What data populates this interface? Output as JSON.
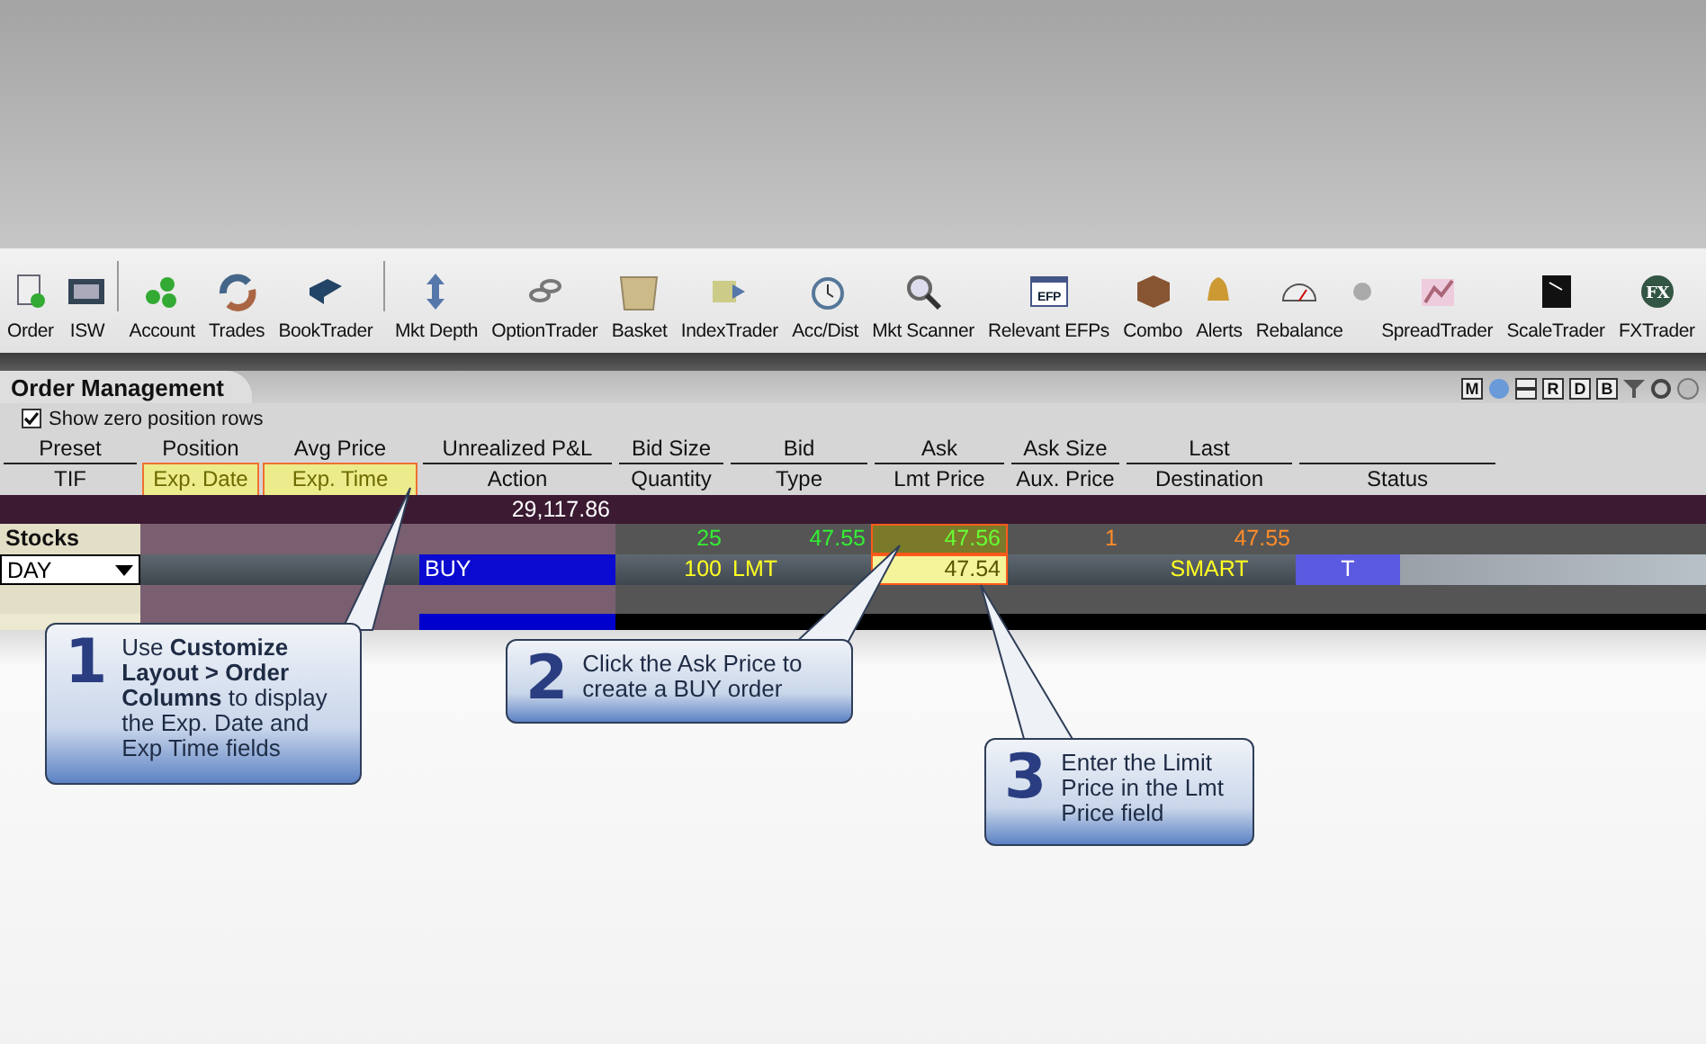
{
  "toolbar": {
    "items": [
      {
        "kind": "order",
        "label": "Order"
      },
      {
        "kind": "monitor",
        "label": "ISW"
      },
      {
        "kind": "separator"
      },
      {
        "kind": "coins",
        "label": "Account"
      },
      {
        "kind": "arrows",
        "label": "Trades"
      },
      {
        "kind": "book",
        "label": "BookTrader"
      },
      {
        "kind": "separator"
      },
      {
        "kind": "updown",
        "label": "Mkt Depth"
      },
      {
        "kind": "chain",
        "label": "OptionTrader"
      },
      {
        "kind": "basket",
        "label": "Basket"
      },
      {
        "kind": "note",
        "label": "IndexTrader"
      },
      {
        "kind": "clock",
        "label": "Acc/Dist"
      },
      {
        "kind": "magnifier",
        "label": "Mkt Scanner"
      },
      {
        "kind": "window",
        "label": "Relevant EFPs",
        "icon_text": "EFP"
      },
      {
        "kind": "cube",
        "label": "Combo"
      },
      {
        "kind": "bell",
        "label": "Alerts"
      },
      {
        "kind": "gauge",
        "label": "Rebalance"
      },
      {
        "kind": "dot"
      },
      {
        "kind": "chart",
        "label": "SpreadTrader"
      },
      {
        "kind": "scale",
        "label": "ScaleTrader"
      },
      {
        "kind": "globe",
        "label": "FXTrader",
        "icon_text": "FX"
      }
    ]
  },
  "panel": {
    "title": "Order Management",
    "view_buttons": [
      {
        "kind": "letter",
        "label": "M"
      },
      {
        "kind": "globe"
      },
      {
        "kind": "lines"
      },
      {
        "kind": "letter",
        "label": "R"
      },
      {
        "kind": "letter",
        "label": "D"
      },
      {
        "kind": "letter",
        "label": "B"
      },
      {
        "kind": "filter"
      },
      {
        "kind": "refresh"
      },
      {
        "kind": "help"
      }
    ],
    "show_zero_rows": {
      "label": "Show zero position rows",
      "checked": true
    },
    "columns": [
      {
        "top": "Preset",
        "bottom": "TIF",
        "highlighted": false
      },
      {
        "top": "Position",
        "bottom": "Exp. Date",
        "highlighted": true
      },
      {
        "top": "Avg Price",
        "bottom": "Exp. Time",
        "highlighted": true
      },
      {
        "top": "Unrealized P&L",
        "bottom": "Action",
        "highlighted": false
      },
      {
        "top": "Bid Size",
        "bottom": "Quantity",
        "highlighted": false
      },
      {
        "top": "Bid",
        "bottom": "Type",
        "highlighted": false
      },
      {
        "top": "Ask",
        "bottom": "Lmt Price",
        "highlighted": false
      },
      {
        "top": "Ask Size",
        "bottom": "Aux. Price",
        "highlighted": false
      },
      {
        "top": "Last",
        "bottom": "Destination",
        "highlighted": false
      },
      {
        "bottom": "Status",
        "highlighted": false
      }
    ],
    "total_row": {
      "unrealized_pnl": "29,117.86"
    },
    "group_row": {
      "label": "Stocks",
      "bid_size": "25",
      "bid": "47.55",
      "ask": {
        "text": "47.56",
        "highlighted": true
      },
      "ask_size": "1",
      "last": "47.55"
    },
    "order_row": {
      "tif": "DAY",
      "action": "BUY",
      "quantity": "100",
      "type": "LMT",
      "lmt_price": {
        "text": "47.54",
        "highlighted": true
      },
      "destination": "SMART",
      "status": "T"
    }
  },
  "callouts": [
    {
      "number": "1",
      "text": "Use **Customize Layout > Order Columns** to display the Exp. Date and Exp Time fields"
    },
    {
      "number": "2",
      "text": "Click the Ask Price to create a BUY order"
    },
    {
      "number": "3",
      "text": "Enter the Limit Price in the Lmt Price field"
    }
  ]
}
